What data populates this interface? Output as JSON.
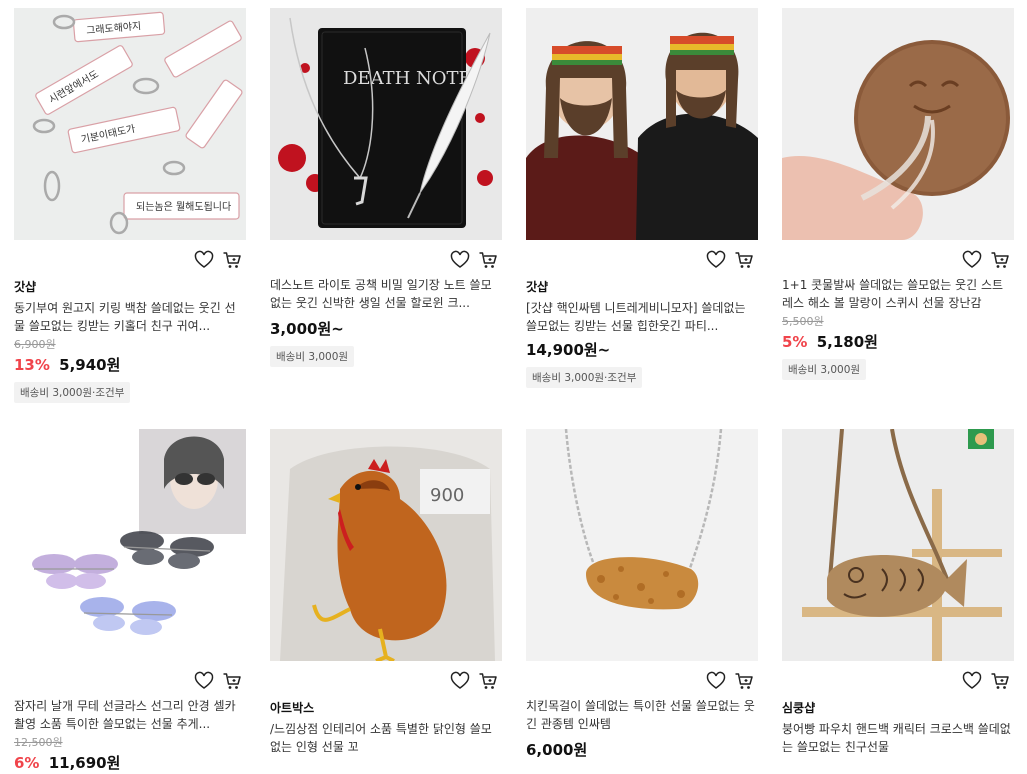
{
  "products": [
    {
      "shop": "갓샵",
      "title": "동기부여 원고지 키링 백참 쓸데없는 웃긴 선물 쓸모없는 킹받는 키홀더 친구 귀여...",
      "original_price": "6,900원",
      "discount": "13%",
      "price": "5,940원",
      "shipping": "배송비 3,000원·조건부"
    },
    {
      "shop": "",
      "title": "데스노트 라이토 공책 비밀 일기장 노트 쓸모없는 웃긴 신박한 생일 선물 할로윈 크...",
      "original_price": "",
      "discount": "",
      "price": "3,000원~",
      "shipping": "배송비 3,000원"
    },
    {
      "shop": "갓샵",
      "title": "[갓샵 핵인싸템 니트레게비니모자] 쓸데없는 쓸모없는 킹받는 선물 힙한웃긴 파티...",
      "original_price": "",
      "discount": "",
      "price": "14,900원~",
      "shipping": "배송비 3,000원·조건부"
    },
    {
      "shop": "",
      "title": "1+1 콧물발싸 쓸데없는 쓸모없는 웃긴 스트레스 해소 볼 말랑이 스퀴시 선물 장난감",
      "original_price": "5,500원",
      "discount": "5%",
      "price": "5,180원",
      "shipping": "배송비 3,000원"
    },
    {
      "shop": "",
      "title": "잠자리 날개 무테 선글라스 선그리 안경 셀카 촬영 소품 특이한 쓸모없는 선물 추게...",
      "original_price": "12,500원",
      "discount": "6%",
      "price": "11,690원",
      "shipping": ""
    },
    {
      "shop": "아트박스",
      "title": "/느낌상점 인테리어 소품 특별한 닭인형 쓸모없는 인형 선물 꼬",
      "original_price": "",
      "discount": "",
      "price": "",
      "shipping": ""
    },
    {
      "shop": "",
      "title": "치킨목걸이 쓸데없는 특이한 선물 쓸모없는 웃긴 관종템 인싸템",
      "original_price": "",
      "discount": "",
      "price": "6,000원",
      "shipping": ""
    },
    {
      "shop": "심쿵샵",
      "title": "붕어빵 파우치 핸드백 캐릭터 크로스백 쓸데없는 쓸모없는 친구선물",
      "original_price": "",
      "discount": "",
      "price": "",
      "shipping": ""
    }
  ],
  "icons": {
    "wishlist": "heart-icon",
    "cart": "cart-icon"
  },
  "colors": {
    "discount": "#f0444b",
    "badge_bg": "#f2f2f2"
  }
}
